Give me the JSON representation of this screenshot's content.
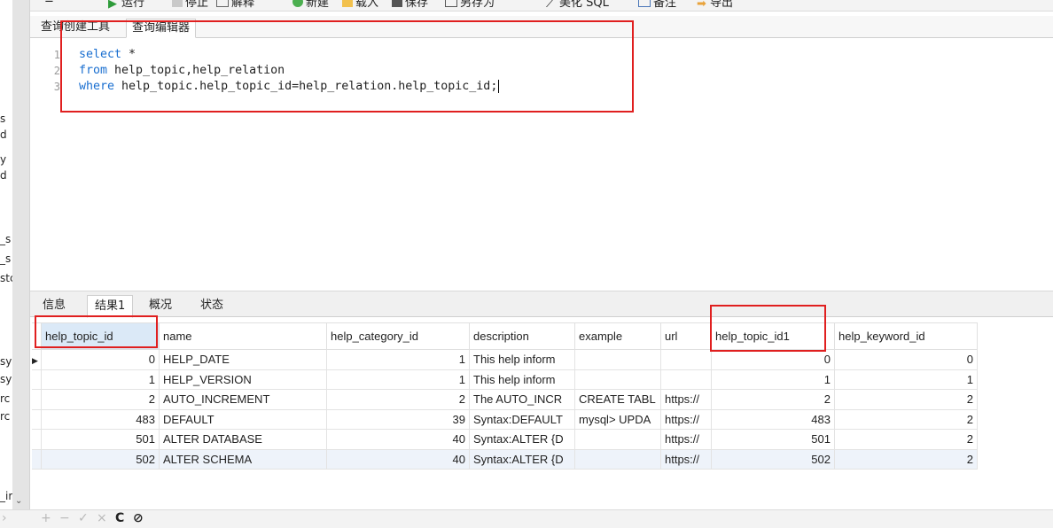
{
  "toolbar": {
    "menu": "≡",
    "run": "运行",
    "stop": "停止",
    "explain": "解释",
    "new": "新建",
    "load": "载入",
    "save": "保存",
    "save_as": "另存为",
    "beautify": "美化 SQL",
    "comment": "备注",
    "export": "导出"
  },
  "editor_tabs": [
    "查询创建工具",
    "查询编辑器"
  ],
  "editor": {
    "line_numbers": [
      "1",
      "2",
      "3"
    ],
    "lines": [
      {
        "kw": "select",
        "rest": " *"
      },
      {
        "kw": "from",
        "rest": " help_topic,help_relation"
      },
      {
        "kw": "where",
        "rest": " help_topic.help_topic_id=help_relation.help_topic_id;"
      }
    ]
  },
  "sidebar_fragments": [
    "s",
    "d",
    "y",
    "d",
    "_s",
    "_s",
    "stc",
    "sy",
    "sy",
    "rc",
    "rc",
    "_ir"
  ],
  "result_tabs": [
    "信息",
    "结果1",
    "概况",
    "状态"
  ],
  "grid": {
    "columns": [
      "help_topic_id",
      "name",
      "help_category_id",
      "description",
      "example",
      "url",
      "help_topic_id1",
      "help_keyword_id"
    ],
    "rows": [
      [
        "0",
        "HELP_DATE",
        "1",
        "This help inform",
        "",
        "",
        "0",
        "0"
      ],
      [
        "1",
        "HELP_VERSION",
        "1",
        "This help inform",
        "",
        "",
        "1",
        "1"
      ],
      [
        "2",
        "AUTO_INCREMENT",
        "2",
        "The AUTO_INCR",
        "CREATE TABL",
        "https://",
        "2",
        "2"
      ],
      [
        "483",
        "DEFAULT",
        "39",
        "Syntax:DEFAULT",
        "mysql> UPDA",
        "https://",
        "483",
        "2"
      ],
      [
        "501",
        "ALTER DATABASE",
        "40",
        "Syntax:ALTER {D",
        "",
        "https://",
        "501",
        "2"
      ],
      [
        "502",
        "ALTER SCHEMA",
        "40",
        "Syntax:ALTER {D",
        "",
        "https://",
        "502",
        "2"
      ]
    ]
  },
  "bottom_bar": {
    "add": "+",
    "remove": "−",
    "apply": "✓",
    "discard": "×",
    "refresh": "C",
    "stop": "⊘"
  },
  "colors": {
    "keyword": "#1a6fd0",
    "highlight_box": "#e01f1f",
    "selected_header": "#dbe9f7"
  }
}
